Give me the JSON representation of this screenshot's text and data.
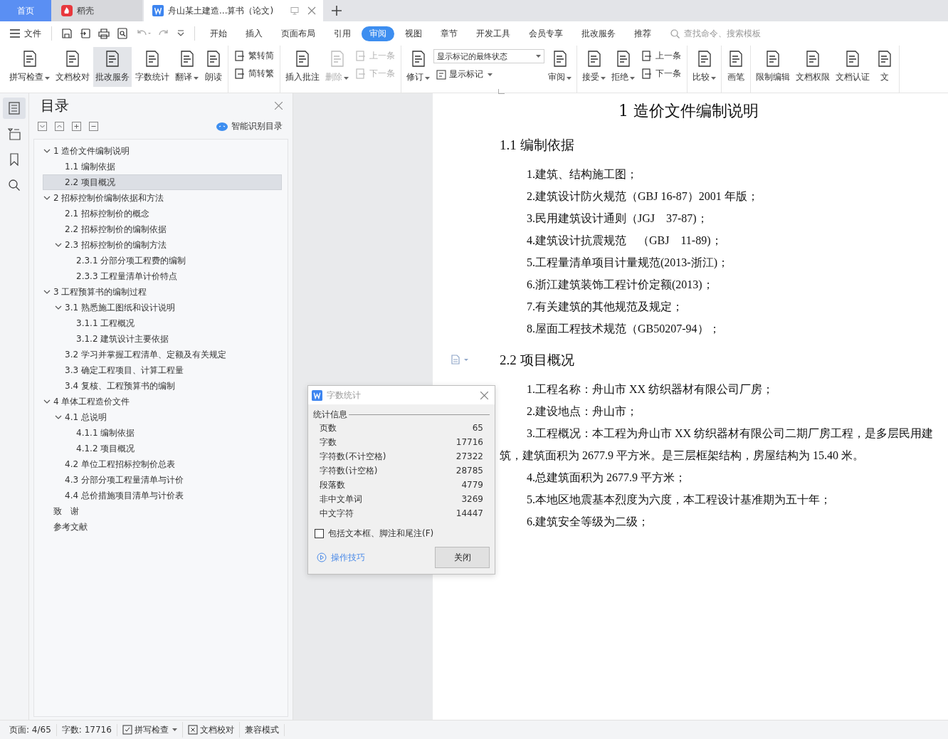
{
  "tabs": [
    {
      "label": "首页",
      "kind": "home",
      "selected": false
    },
    {
      "label": "稻壳",
      "kind": "app",
      "selected": false
    },
    {
      "label": "舟山某土建造...算书（论文)",
      "kind": "doc",
      "selected": true
    }
  ],
  "menu": {
    "file": "文件",
    "items": [
      {
        "label": "开始",
        "selected": false
      },
      {
        "label": "插入",
        "selected": false
      },
      {
        "label": "页面布局",
        "selected": false
      },
      {
        "label": "引用",
        "selected": false
      },
      {
        "label": "审阅",
        "selected": true
      },
      {
        "label": "视图",
        "selected": false
      },
      {
        "label": "章节",
        "selected": false
      },
      {
        "label": "开发工具",
        "selected": false
      },
      {
        "label": "会员专享",
        "selected": false
      },
      {
        "label": "批改服务",
        "selected": false
      },
      {
        "label": "推荐",
        "selected": false
      }
    ],
    "search": {
      "placeholder": "查找命令、搜索模板"
    }
  },
  "ribbon": [
    [
      {
        "kind": "big",
        "label": "拼写检查",
        "dropdown": true,
        "disabled": false,
        "highlighted": false
      },
      {
        "kind": "big",
        "label": "文档校对",
        "dropdown": false,
        "disabled": false,
        "highlighted": false
      },
      {
        "kind": "big",
        "label": "批改服务",
        "dropdown": false,
        "disabled": false,
        "highlighted": true
      },
      {
        "kind": "big",
        "label": "字数统计",
        "dropdown": false,
        "disabled": false,
        "highlighted": false
      },
      {
        "kind": "big",
        "label": "翻译",
        "dropdown": true,
        "disabled": false,
        "highlighted": false
      },
      {
        "kind": "big",
        "label": "朗读",
        "dropdown": false,
        "disabled": false,
        "highlighted": false
      }
    ],
    [
      {
        "kind": "pair",
        "top": {
          "label": "繁转简",
          "disabled": false
        },
        "bottom": {
          "label": "简转繁",
          "disabled": false
        }
      }
    ],
    [
      {
        "kind": "big",
        "label": "插入批注",
        "dropdown": false,
        "disabled": false,
        "highlighted": false
      },
      {
        "kind": "big",
        "label": "删除",
        "dropdown": true,
        "disabled": true,
        "highlighted": false
      },
      {
        "kind": "pair",
        "top": {
          "label": "上一条",
          "disabled": true
        },
        "bottom": {
          "label": "下一条",
          "disabled": true
        }
      }
    ],
    [
      {
        "kind": "big",
        "label": "修订",
        "dropdown": true,
        "disabled": false,
        "highlighted": false
      },
      {
        "kind": "select",
        "value": "显示标记的最终状态",
        "sub": "显示标记"
      },
      {
        "kind": "big",
        "label": "审阅",
        "dropdown": true,
        "disabled": false,
        "highlighted": false
      }
    ],
    [
      {
        "kind": "big",
        "label": "接受",
        "dropdown": true,
        "disabled": false,
        "highlighted": false
      },
      {
        "kind": "big",
        "label": "拒绝",
        "dropdown": true,
        "disabled": false,
        "highlighted": false
      },
      {
        "kind": "pair",
        "top": {
          "label": "上一条",
          "disabled": false
        },
        "bottom": {
          "label": "下一条",
          "disabled": false
        }
      }
    ],
    [
      {
        "kind": "big",
        "label": "比较",
        "dropdown": true,
        "disabled": false,
        "highlighted": false
      }
    ],
    [
      {
        "kind": "big",
        "label": "画笔",
        "dropdown": false,
        "disabled": false,
        "highlighted": false
      }
    ],
    [
      {
        "kind": "big",
        "label": "限制编辑",
        "dropdown": false,
        "disabled": false,
        "highlighted": false
      },
      {
        "kind": "big",
        "label": "文档权限",
        "dropdown": false,
        "disabled": false,
        "highlighted": false
      },
      {
        "kind": "big",
        "label": "文档认证",
        "dropdown": false,
        "disabled": false,
        "highlighted": false
      },
      {
        "kind": "big",
        "label": "文",
        "dropdown": false,
        "disabled": false,
        "highlighted": false
      }
    ]
  ],
  "rail": [
    {
      "kind": "toc",
      "selected": true
    },
    {
      "kind": "outline",
      "selected": false
    },
    {
      "kind": "bookmark",
      "selected": false
    },
    {
      "kind": "search",
      "selected": false
    }
  ],
  "nav": {
    "title": "目录",
    "smart": "智能识别目录",
    "tree": [
      {
        "label": "1 造价文件编制说明",
        "selected": false,
        "expanded": true,
        "children": [
          {
            "label": "1.1 编制依据",
            "selected": false
          },
          {
            "label": "2.2  项目概况",
            "selected": true
          }
        ]
      },
      {
        "label": "2 招标控制价编制依据和方法",
        "selected": false,
        "expanded": true,
        "children": [
          {
            "label": "2.1 招标控制价的概念",
            "selected": false
          },
          {
            "label": "2.2 招标控制价的编制依据",
            "selected": false
          },
          {
            "label": "2.3 招标控制价的编制方法",
            "selected": false,
            "expanded": true,
            "children": [
              {
                "label": "2.3.1 分部分项工程费的编制",
                "selected": false
              },
              {
                "label": "2.3.3 工程量清单计价特点",
                "selected": false
              }
            ]
          }
        ]
      },
      {
        "label": "3 工程预算书的编制过程",
        "selected": false,
        "expanded": true,
        "children": [
          {
            "label": "3.1 熟悉施工图纸和设计说明",
            "selected": false,
            "expanded": true,
            "children": [
              {
                "label": "3.1.1 工程概况",
                "selected": false
              },
              {
                "label": "3.1.2 建筑设计主要依据",
                "selected": false
              }
            ]
          },
          {
            "label": "3.2 学习并掌握工程清单、定额及有关规定",
            "selected": false
          },
          {
            "label": "3.3 确定工程项目、计算工程量",
            "selected": false
          },
          {
            "label": "3.4 复核、工程预算书的编制",
            "selected": false
          }
        ]
      },
      {
        "label": "4 单体工程造价文件",
        "selected": false,
        "expanded": true,
        "children": [
          {
            "label": "4.1 总说明",
            "selected": false,
            "expanded": true,
            "children": [
              {
                "label": "4.1.1 编制依据",
                "selected": false
              },
              {
                "label": "4.1.2 项目概况",
                "selected": false
              }
            ]
          },
          {
            "label": "4.2 单位工程招标控制价总表",
            "selected": false
          },
          {
            "label": "4.3 分部分项工程量清单与计价",
            "selected": false
          },
          {
            "label": "4.4 总价措施项目清单与计价表",
            "selected": false
          }
        ]
      },
      {
        "label": "致　谢",
        "selected": false
      },
      {
        "label": "参考文献",
        "selected": false
      }
    ]
  },
  "document": [
    {
      "kind": "h1",
      "text": "1 造价文件编制说明"
    },
    {
      "kind": "h2",
      "text": "1.1 编制依据"
    },
    {
      "kind": "p",
      "text": "1.建筑、结构施工图；"
    },
    {
      "kind": "p",
      "text": "2.建筑设计防火规范（GBJ 16-87）2001 年版；"
    },
    {
      "kind": "p",
      "text": "3.民用建筑设计通则（JGJ　37-87)；"
    },
    {
      "kind": "p",
      "text": "4.建筑设计抗震规范　（GBJ　11-89)；"
    },
    {
      "kind": "p",
      "text": "5.工程量清单项目计量规范(2013-浙江)；"
    },
    {
      "kind": "p",
      "text": "6.浙江建筑装饰工程计价定额(2013)；"
    },
    {
      "kind": "p",
      "text": "7.有关建筑的其他规范及规定；"
    },
    {
      "kind": "p",
      "text": "8.屋面工程技术规范（GB50207-94）；"
    },
    {
      "kind": "h2",
      "text": "2.2  项目概况"
    },
    {
      "kind": "p",
      "text": "1.工程名称：舟山市 XX 纺织器材有限公司厂房；"
    },
    {
      "kind": "p",
      "text": "2.建设地点：舟山市；"
    },
    {
      "kind": "p",
      "text": "3.工程概况：本工程为舟山市 XX 纺织器材有限公司二期厂房工程，是多层民用建筑，建筑面积为 2677.9 平方米。是三层框架结构，房屋结构为 15.40 米。"
    },
    {
      "kind": "p",
      "text": "4.总建筑面积为 2677.9 平方米；"
    },
    {
      "kind": "p",
      "text": "5.本地区地震基本烈度为六度，本工程设计基准期为五十年；"
    },
    {
      "kind": "p",
      "text": "6.建筑安全等级为二级；"
    }
  ],
  "dialog": {
    "title": "字数统计",
    "section": "统计信息",
    "rows": [
      {
        "label": "页数",
        "value": "65"
      },
      {
        "label": "字数",
        "value": "17716"
      },
      {
        "label": "字符数(不计空格)",
        "value": "27322"
      },
      {
        "label": "字符数(计空格)",
        "value": "28785"
      },
      {
        "label": "段落数",
        "value": "4779"
      },
      {
        "label": "非中文单词",
        "value": "3269"
      },
      {
        "label": "中文字符",
        "value": "14447"
      }
    ],
    "checkbox": {
      "label": "包括文本框、脚注和尾注(F)",
      "checked": false
    },
    "tips": "操作技巧",
    "close": "关闭"
  },
  "status_bar": {
    "page": "页面: 4/65",
    "words": "字数: 17716",
    "spell": "拼写检查",
    "proof": "文档校对",
    "mode": "兼容模式"
  }
}
